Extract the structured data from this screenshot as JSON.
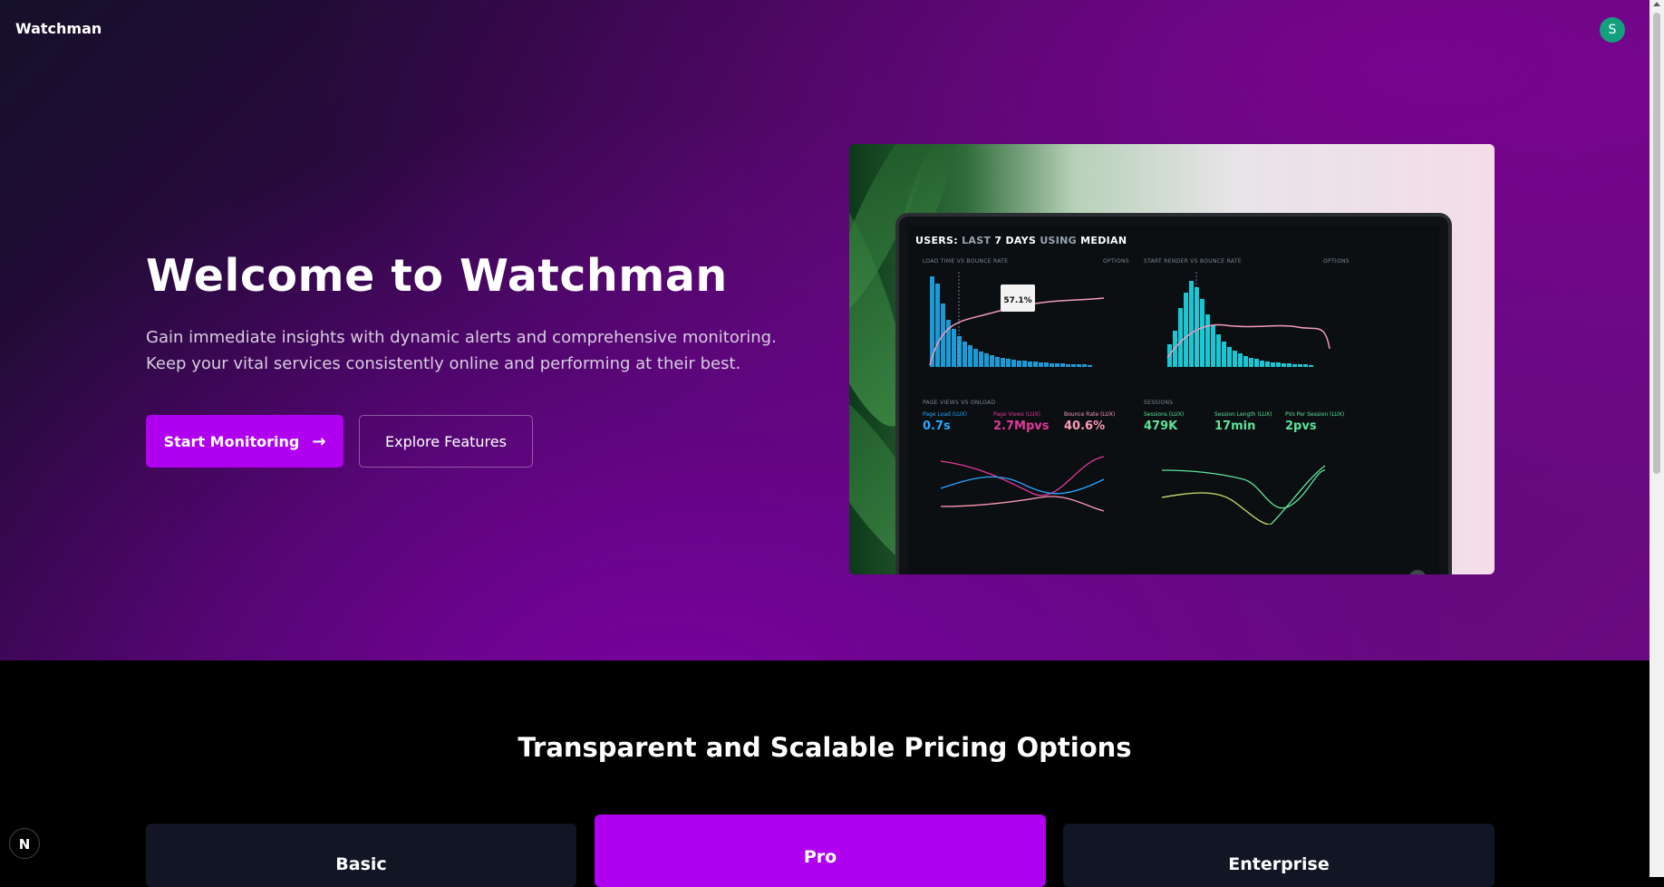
{
  "navbar": {
    "brand": "Watchman",
    "avatar_initial": "S"
  },
  "hero": {
    "title": "Welcome to Watchman",
    "subtitle": "Gain immediate insights with dynamic alerts and comprehensive monitoring. Keep your vital services consistently online and performing at their best.",
    "primary_button": "Start Monitoring",
    "secondary_button": "Explore Features"
  },
  "dashboard_image": {
    "screen_title_prefix": "USERS:",
    "screen_title_dim": "LAST",
    "screen_title_rest": "7 DAYS",
    "screen_title_using": "USING",
    "screen_title_median": "MEDIAN",
    "panel_1": "LOAD TIME VS BOUNCE RATE",
    "panel_2": "START RENDER VS BOUNCE RATE",
    "panel_3": "PAGE VIEWS VS ONLOAD",
    "panel_4": "SESSIONS",
    "options_label": "OPTIONS",
    "tooltip_value": "57.1%",
    "kpis": [
      {
        "label": "Page Load (LUX)",
        "value": "0.7s",
        "color": "#2aa7ff"
      },
      {
        "label": "Page Views (LUX)",
        "value": "2.7Mpvs",
        "color": "#e0399a"
      },
      {
        "label": "Bounce Rate (LUX)",
        "value": "40.6%",
        "color": "#ff9bb6"
      },
      {
        "label": "Sessions (LUX)",
        "value": "479K",
        "color": "#5fe39a"
      },
      {
        "label": "Session Length (LUX)",
        "value": "17min",
        "color": "#5fe39a"
      },
      {
        "label": "PVs Per Session (LUX)",
        "value": "2pvs",
        "color": "#5fe39a"
      }
    ]
  },
  "pricing": {
    "title": "Transparent and Scalable Pricing Options",
    "plans": [
      {
        "name": "Basic"
      },
      {
        "name": "Pro"
      },
      {
        "name": "Enterprise"
      }
    ]
  },
  "dev_badge": "N",
  "colors": {
    "accent": "#b000f0",
    "avatar": "#13a07e",
    "card_bg": "#121624"
  }
}
